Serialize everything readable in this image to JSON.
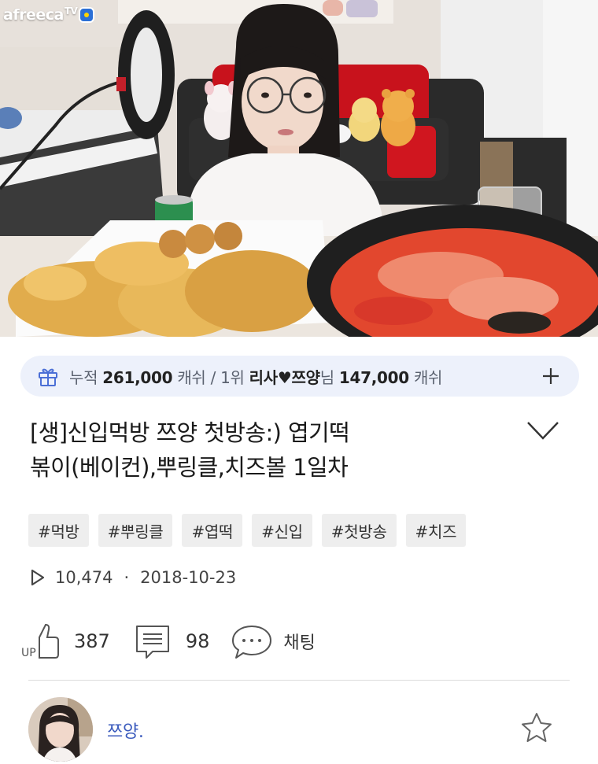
{
  "player": {
    "logo_text": "afreeca",
    "logo_tv": "TV"
  },
  "donation": {
    "prefix": "누적",
    "total": "261,000",
    "unit1": "캐쉬 / 1위",
    "top_name": "리사♥쯔양",
    "honorific": "님",
    "top_amount": "147,000",
    "unit2": "캐쉬",
    "icon": "gift-icon",
    "expand_icon": "plus-icon"
  },
  "video": {
    "title_line1": "[생]신입먹방 쯔양 첫방송:) 엽기떡",
    "title_line2": "볶이(베이컨),뿌링클,치즈볼 1일차",
    "expand_icon": "chevron-down-icon",
    "tags": [
      "#먹방",
      "#뿌링클",
      "#엽떡",
      "#신입",
      "#첫방송",
      "#치즈"
    ],
    "views": "10,474",
    "separator": "·",
    "date": "2018-10-23"
  },
  "actions": {
    "like_icon": "thumbs-up-icon",
    "like_badge": "UP",
    "likes": "387",
    "comment_icon": "comment-icon",
    "comments": "98",
    "chat_icon": "chat-bubble-icon",
    "chat_label": "채팅"
  },
  "channel": {
    "name": "쯔양.",
    "favorite_icon": "star-icon"
  },
  "colors": {
    "donation_bg": "#edf1fb",
    "channel_link": "#3b5bbd",
    "tag_bg": "#eeeeee",
    "icon_accent": "#4b6fd6"
  }
}
